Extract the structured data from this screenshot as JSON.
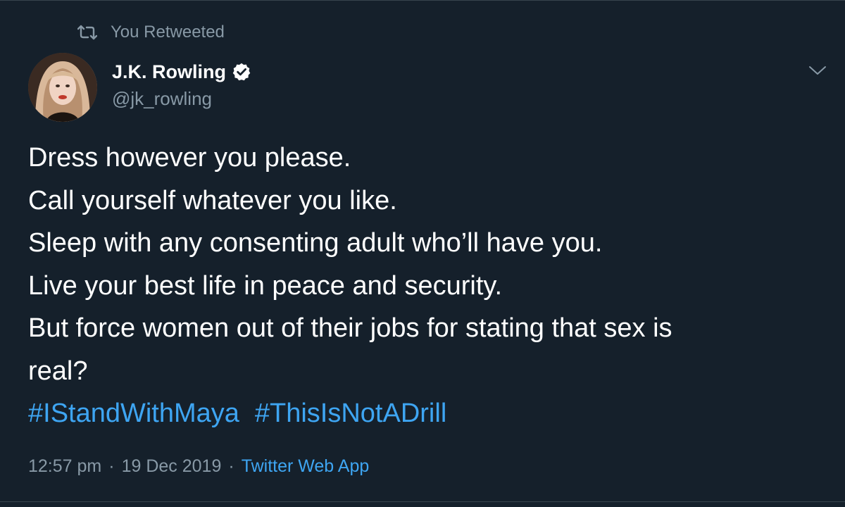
{
  "colors": {
    "background": "#15202b",
    "secondary_text": "#8899a6",
    "link": "#3ea5f2",
    "divider": "#38444d"
  },
  "retweet": {
    "icon": "retweet-icon",
    "label": "You Retweeted"
  },
  "author": {
    "avatar": "avatar",
    "name": "J.K. Rowling",
    "verified_icon": "verified-badge-icon",
    "handle": "@jk_rowling"
  },
  "menu_icon": "chevron-down-icon",
  "tweet": {
    "lines": [
      "Dress however you please.",
      "Call yourself whatever you like.",
      "Sleep with any consenting adult who’ll have you.",
      "Live your best life in peace and security.",
      "But force women out of their jobs for stating that sex is",
      "real?"
    ],
    "hashtags": [
      "#IStandWithMaya",
      "#ThisIsNotADrill"
    ]
  },
  "meta": {
    "time": "12:57 pm",
    "separator": "·",
    "date": "19 Dec 2019",
    "source": "Twitter Web App"
  }
}
